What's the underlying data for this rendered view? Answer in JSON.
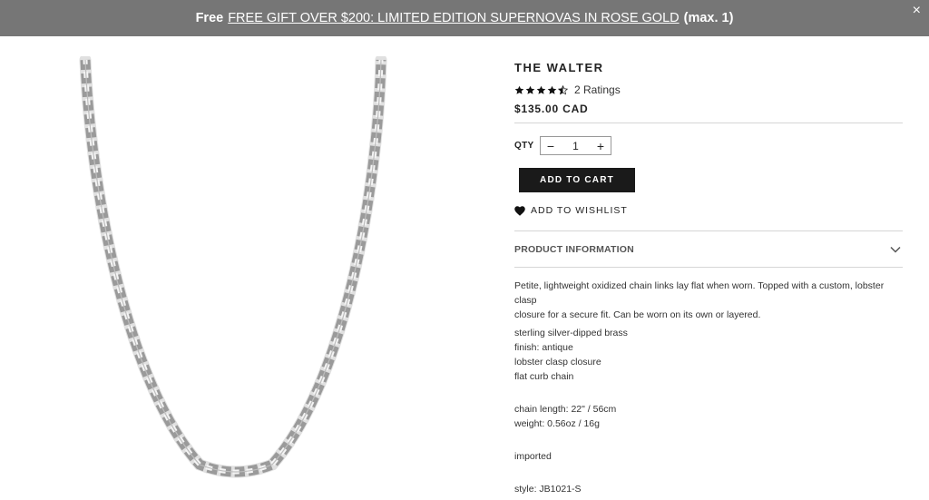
{
  "promo": {
    "free_label": "Free",
    "link_text": "FREE GIFT OVER $200: LIMITED EDITION SUPERNOVAS IN ROSE GOLD",
    "max_text": "(max. 1)",
    "close_glyph": "×"
  },
  "product": {
    "title": "THE WALTER",
    "rating_value": 4.5,
    "rating_count": "2 Ratings",
    "price": "$135.00 CAD",
    "qty_label": "QTY",
    "qty_minus": "−",
    "qty_value": "1",
    "qty_plus": "+",
    "add_to_cart": "ADD TO CART",
    "wishlist": "ADD TO WISHLIST",
    "info_header": "PRODUCT INFORMATION",
    "description": [
      "Petite, lightweight oxidized chain links lay flat when worn. Topped with a custom, lobster clasp",
      "closure for a secure fit. Can be worn on its own or layered."
    ],
    "specs": [
      "sterling silver-dipped brass",
      "finish: antique",
      "lobster clasp closure",
      "flat curb chain"
    ],
    "dimensions": [
      "chain length: 22\" / 56cm",
      "weight: 0.56oz / 16g"
    ],
    "origin": "imported",
    "style": "style: JB1021-S"
  },
  "colors": {
    "promo_bg": "#767676",
    "button_bg": "#1a1a1a",
    "divider": "#d6d6d6"
  },
  "icons": {
    "close": "close-icon",
    "star": "star-icon",
    "heart": "heart-icon",
    "chevron": "chevron-down-icon",
    "product_image": "silver-curb-chain-necklace"
  }
}
